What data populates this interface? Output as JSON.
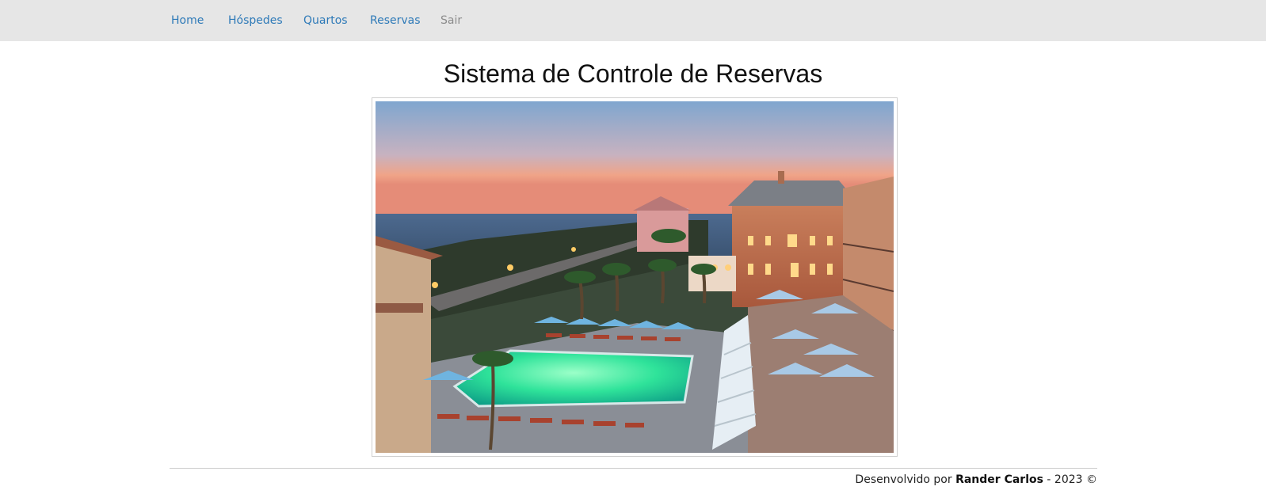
{
  "nav": {
    "items": [
      {
        "label": "Home"
      },
      {
        "label": "Hóspedes"
      },
      {
        "label": "Quartos"
      },
      {
        "label": "Reservas"
      },
      {
        "label": "Sair"
      }
    ]
  },
  "main": {
    "title": "Sistema de Controle de Reservas",
    "hero_image": "hotel-pool-sunset-photo"
  },
  "footer": {
    "prefix": "Desenvolvido por",
    "author": "Rander Carlos",
    "suffix": "- 2023 ©"
  },
  "colors": {
    "navbar_bg": "#e6e6e6",
    "link": "#2e7ab8",
    "link_muted": "#8c8c8c"
  }
}
